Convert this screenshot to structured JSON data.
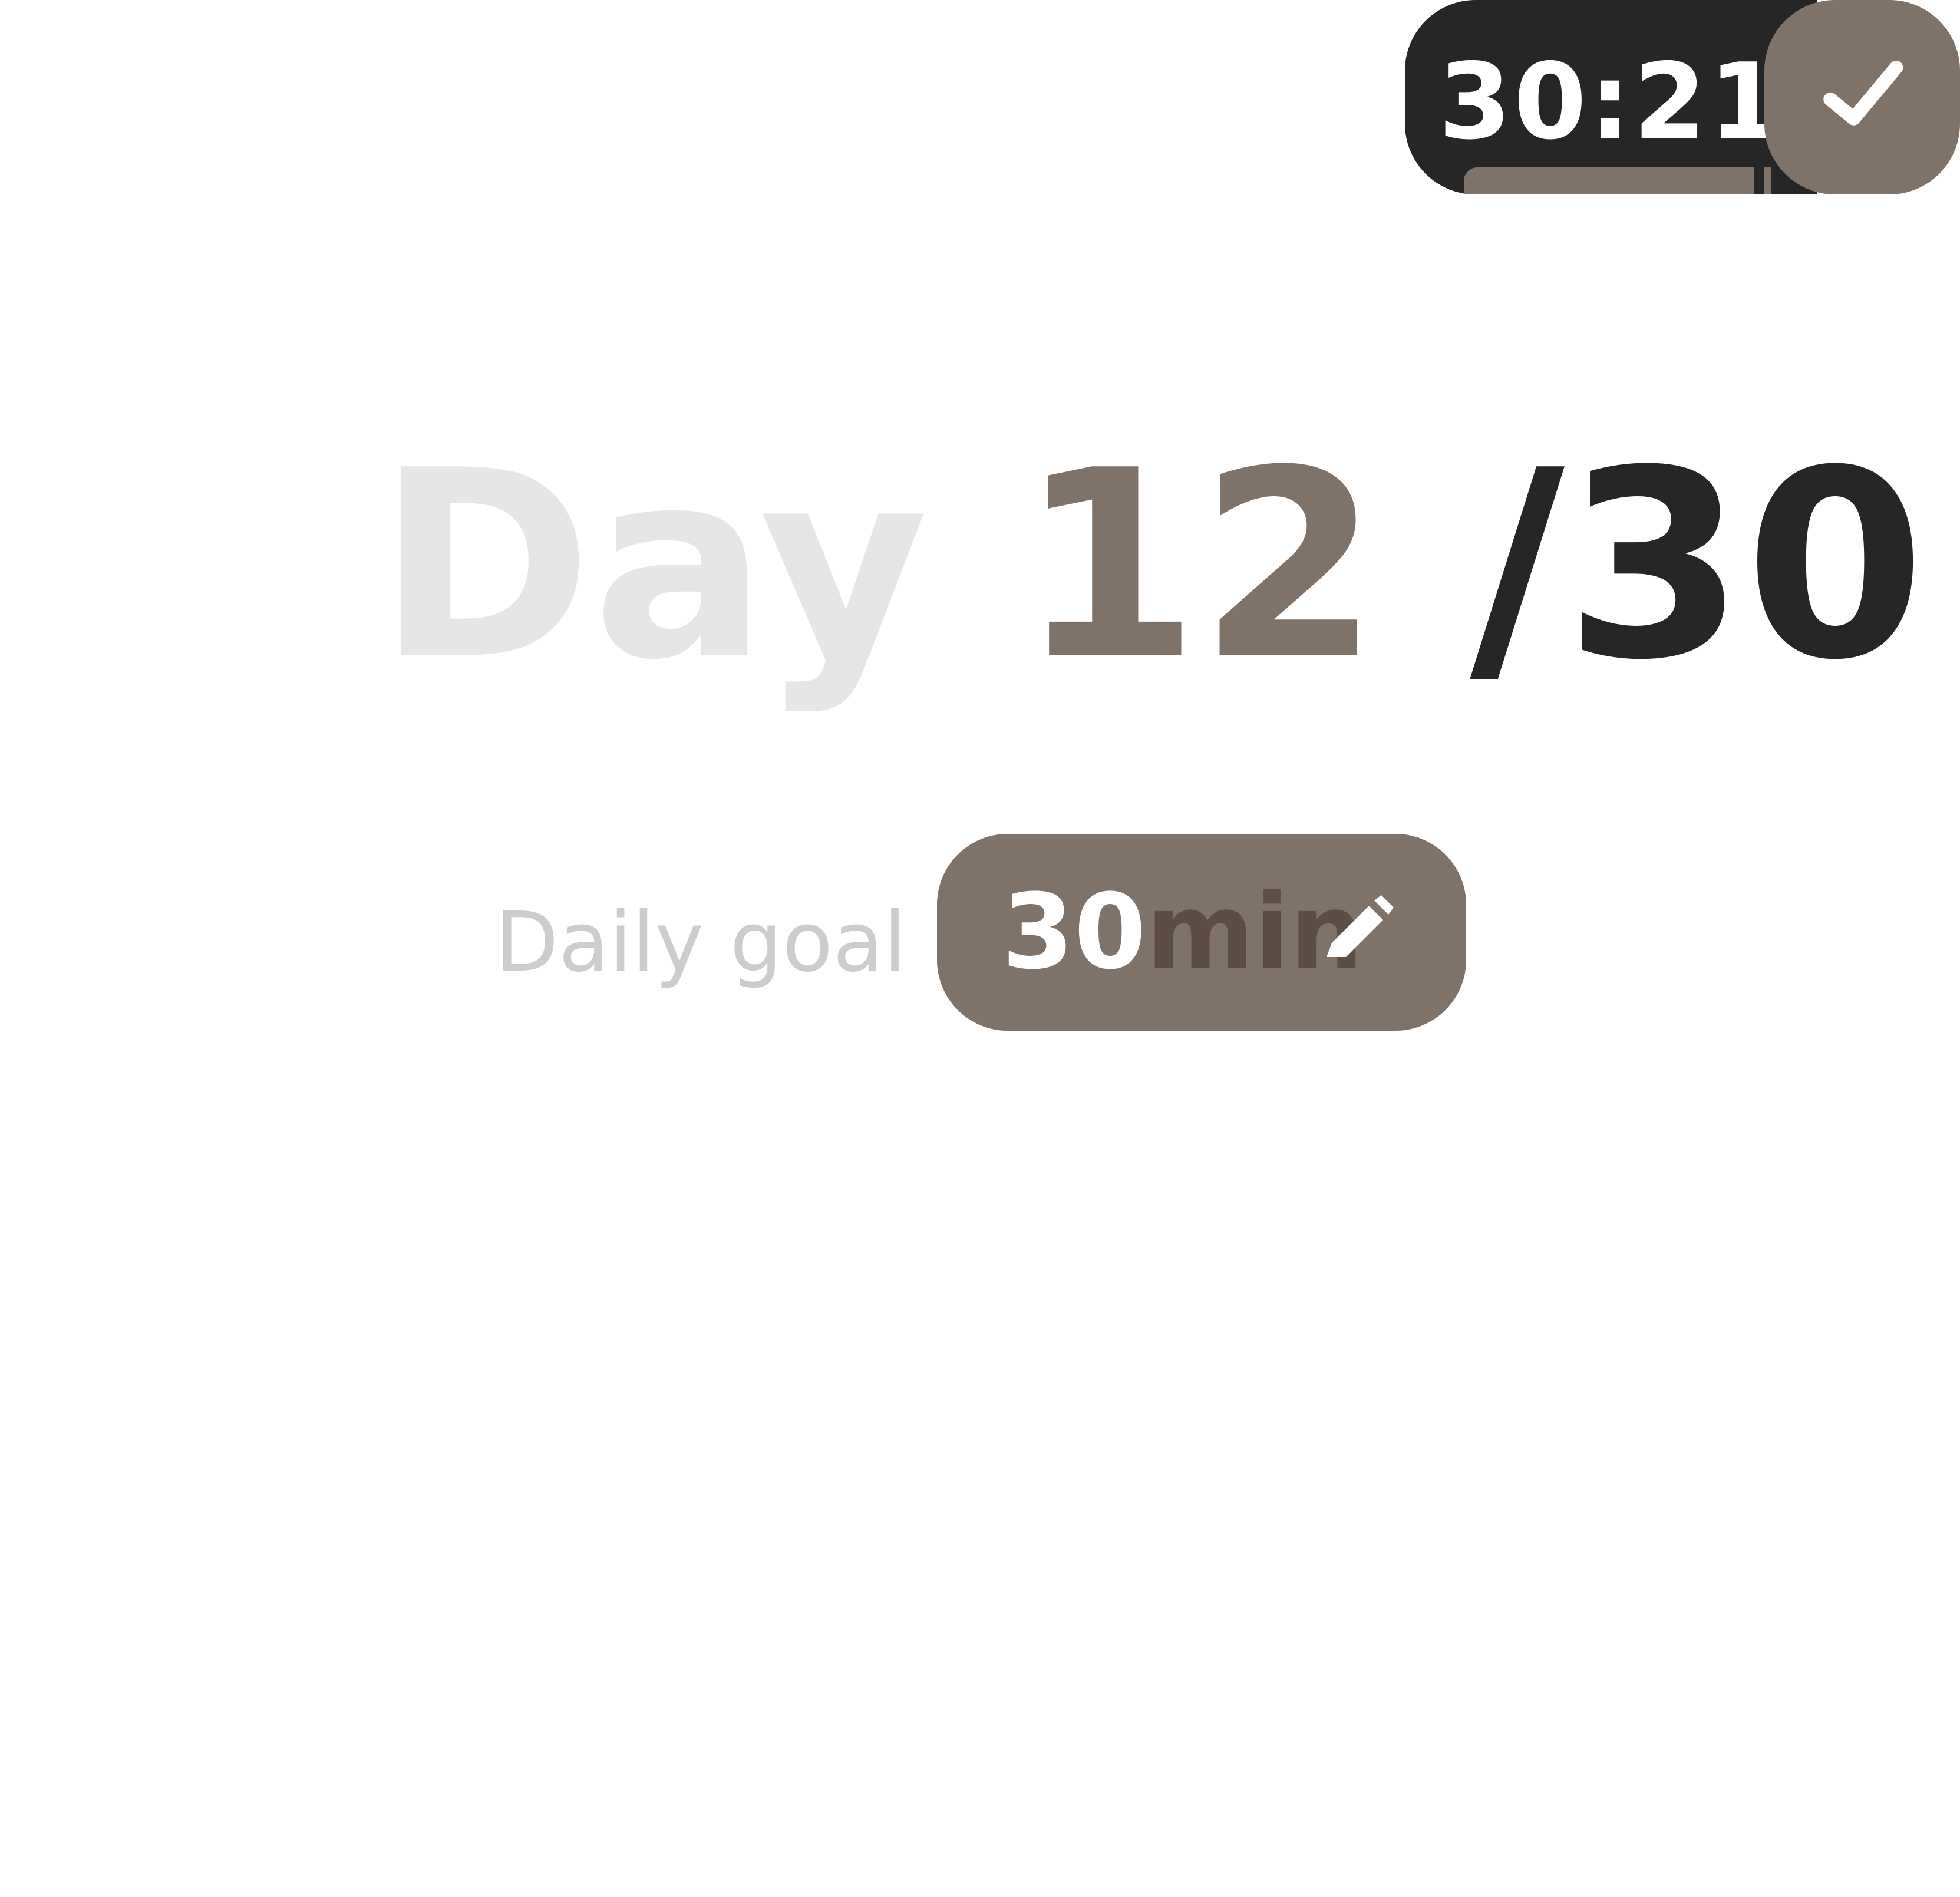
{
  "timer": {
    "time": "30:21",
    "progress": 0.87,
    "complete_icon": "check-icon"
  },
  "day": {
    "label": "Day",
    "current": "12",
    "separator": "/",
    "total": "30"
  },
  "goal": {
    "label": "Daily goal",
    "value": "30",
    "unit": "min",
    "edit_icon": "pencil-icon"
  },
  "colors": {
    "accent": "#7f7268",
    "dark": "#262626",
    "unit_text": "#5d4e45",
    "muted_text": "#cccccc",
    "light_text": "#e6e6e6"
  }
}
